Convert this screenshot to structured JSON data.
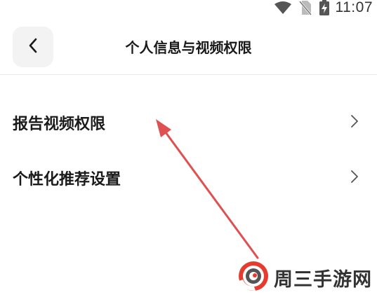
{
  "status_bar": {
    "time": "11:07",
    "icons": [
      "wifi-icon",
      "no-sim-icon",
      "battery-charging-icon"
    ]
  },
  "header": {
    "back_icon": "chevron-left-icon",
    "title": "个人信息与视频权限"
  },
  "settings": {
    "items": [
      {
        "label": "报告视频权限",
        "icon": "chevron-right-icon"
      },
      {
        "label": "个性化推荐设置",
        "icon": "chevron-right-icon"
      }
    ]
  },
  "annotation": {
    "color": "#e05050",
    "points_to": "报告视频权限"
  },
  "watermark": {
    "text": "周三手游网",
    "logo_colors": [
      "#e63b2e",
      "#555555"
    ]
  }
}
